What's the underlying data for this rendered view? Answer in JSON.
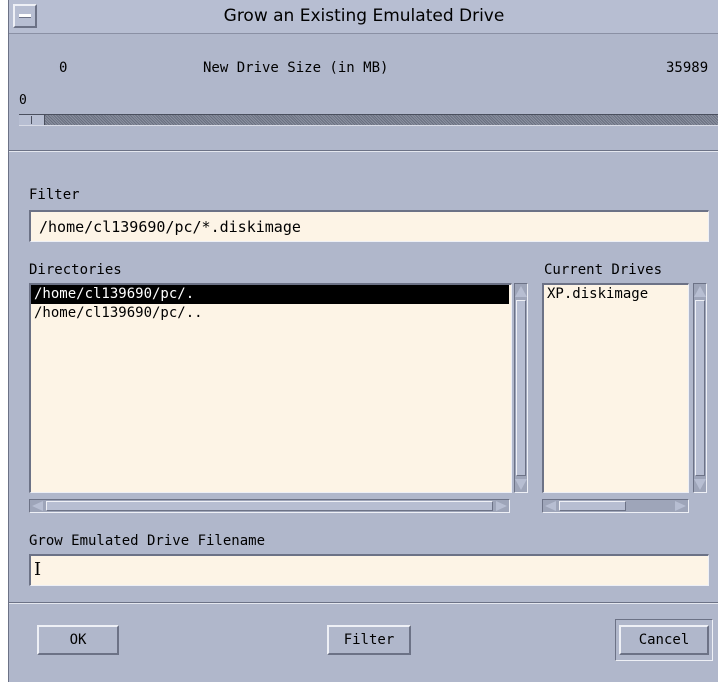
{
  "window": {
    "title": "Grow an Existing Emulated Drive"
  },
  "size_scale": {
    "min_label": "0",
    "caption": "New Drive Size (in MB)",
    "max_label": "35989",
    "current_value": "0",
    "level_fraction": 0
  },
  "filter": {
    "label": "Filter",
    "value": "/home/cl139690/pc/*.diskimage"
  },
  "directories": {
    "label": "Directories",
    "items": [
      {
        "label": "/home/cl139690/pc/.",
        "selected": true
      },
      {
        "label": "/home/cl139690/pc/..",
        "selected": false
      }
    ]
  },
  "drives": {
    "label": "Current Drives",
    "items": [
      {
        "label": "XP.diskimage",
        "selected": false
      }
    ]
  },
  "filename": {
    "label": "Grow Emulated Drive Filename",
    "value": ""
  },
  "buttons": {
    "ok": "OK",
    "filter": "Filter",
    "cancel": "Cancel"
  },
  "colors": {
    "dialog_bg": "#b0b7cb",
    "field_bg": "#fdf4e6",
    "selection_bg": "#000000"
  }
}
